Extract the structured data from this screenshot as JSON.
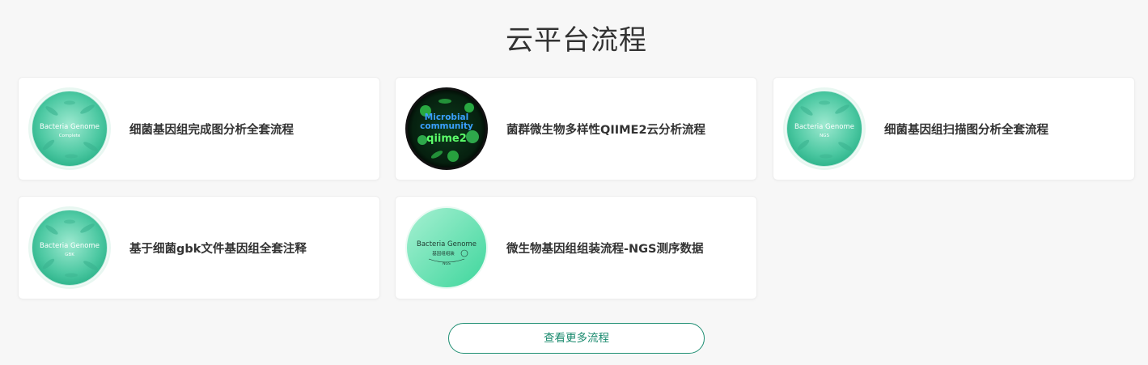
{
  "section": {
    "title": "云平台流程"
  },
  "pipelines": [
    {
      "label": "细菌基因组完成图分析全套流程",
      "thumbnail_text": [
        "Bacteria Genome",
        "Complete"
      ]
    },
    {
      "label": "菌群微生物多样性QIIME2云分析流程",
      "thumbnail_text": [
        "Microbial",
        "community",
        "qiime2"
      ]
    },
    {
      "label": "细菌基因组扫描图分析全套流程",
      "thumbnail_text": [
        "Bacteria Genome",
        "NGS"
      ]
    },
    {
      "label": "基于细菌gbk文件基因组全套注释",
      "thumbnail_text": [
        "Bacteria Genome",
        "GBK"
      ]
    },
    {
      "label": "微生物基因组组装流程-NGS测序数据",
      "thumbnail_text": [
        "Bacteria Genome",
        "基因组组装",
        "NGS"
      ]
    }
  ],
  "more_button": {
    "label": "查看更多流程"
  },
  "colors": {
    "accent": "#1a8a6e",
    "petri_green": "#5fd0ad",
    "qiime_dark": "#04140c",
    "qiime_blue_text": "#3aa0ff",
    "qiime_green_text": "#5cff6a"
  },
  "icons": {
    "card_1": "bacteria-petri-dish-icon",
    "card_2": "microbial-community-icon",
    "card_3": "bacteria-petri-dish-icon",
    "card_4": "bacteria-petri-dish-icon",
    "card_5": "bacteria-genome-assembly-icon"
  }
}
